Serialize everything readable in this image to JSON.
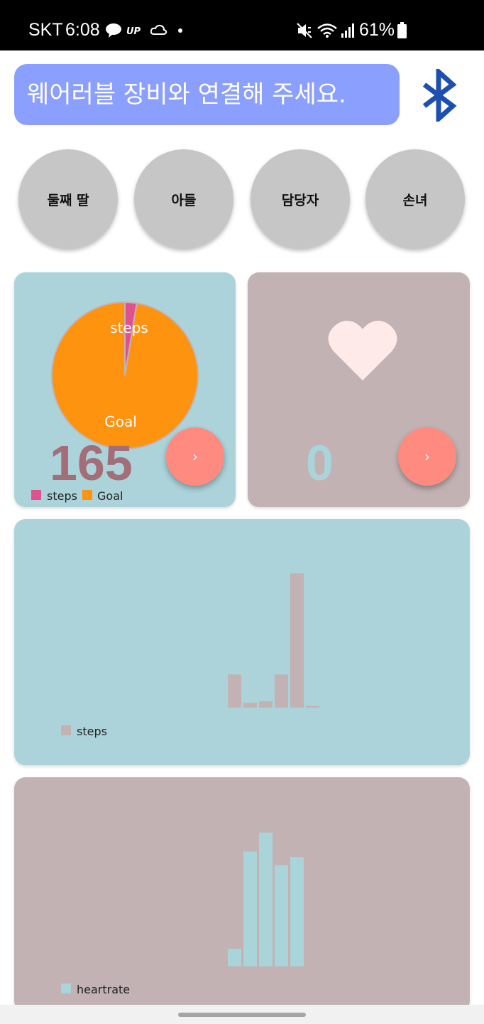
{
  "status_bar": {
    "carrier": "SKT",
    "time": "6:08",
    "battery": "61%",
    "icons": [
      "talk-icon",
      "up-icon",
      "cloud-icon",
      "dot-icon",
      "mute-icon",
      "wifi-icon",
      "signal-icon",
      "battery-icon"
    ]
  },
  "banner": {
    "text": "웨어러블 장비와 연결해 주세요."
  },
  "bluetooth": {
    "icon": "bluetooth-icon",
    "color": "#1e4fb0"
  },
  "contacts": [
    {
      "label": "둘째 딸"
    },
    {
      "label": "아들"
    },
    {
      "label": "담당자"
    },
    {
      "label": "손녀"
    }
  ],
  "steps_card": {
    "bg": "#abd3d9",
    "value": "165",
    "value_color": "#a36e77",
    "button_label": "›",
    "pie": {
      "steps_fraction": 0.026,
      "labels": {
        "steps": "steps",
        "goal": "Goal"
      },
      "colors": {
        "steps": "#e0528f",
        "goal": "#fd930f"
      }
    },
    "legend": [
      {
        "label": "steps",
        "color": "#e0528f"
      },
      {
        "label": "Goal",
        "color": "#fd930f"
      }
    ]
  },
  "heart_card": {
    "bg": "#c2b2b3",
    "value": "0",
    "value_color": "#a8d4da",
    "button_label": "›",
    "heart_icon": "heart-icon",
    "heart_color": "#ffeaea"
  },
  "steps_chart": {
    "bg": "#abd3d9",
    "bar_color": "#c2b2b3",
    "legend_label": "steps",
    "chart_data": {
      "type": "bar",
      "series": [
        {
          "name": "steps",
          "values": [
            21,
            3,
            4,
            21,
            85,
            1
          ]
        }
      ],
      "ylim": [
        0,
        100
      ]
    }
  },
  "heartrate_chart": {
    "bg": "#c2b2b3",
    "bar_color": "#a8d4da",
    "legend_label": "heartrate",
    "chart_data": {
      "type": "bar",
      "series": [
        {
          "name": "heartrate",
          "values": [
            13,
            85,
            99,
            75,
            81
          ]
        }
      ],
      "ylim": [
        0,
        100
      ]
    }
  }
}
